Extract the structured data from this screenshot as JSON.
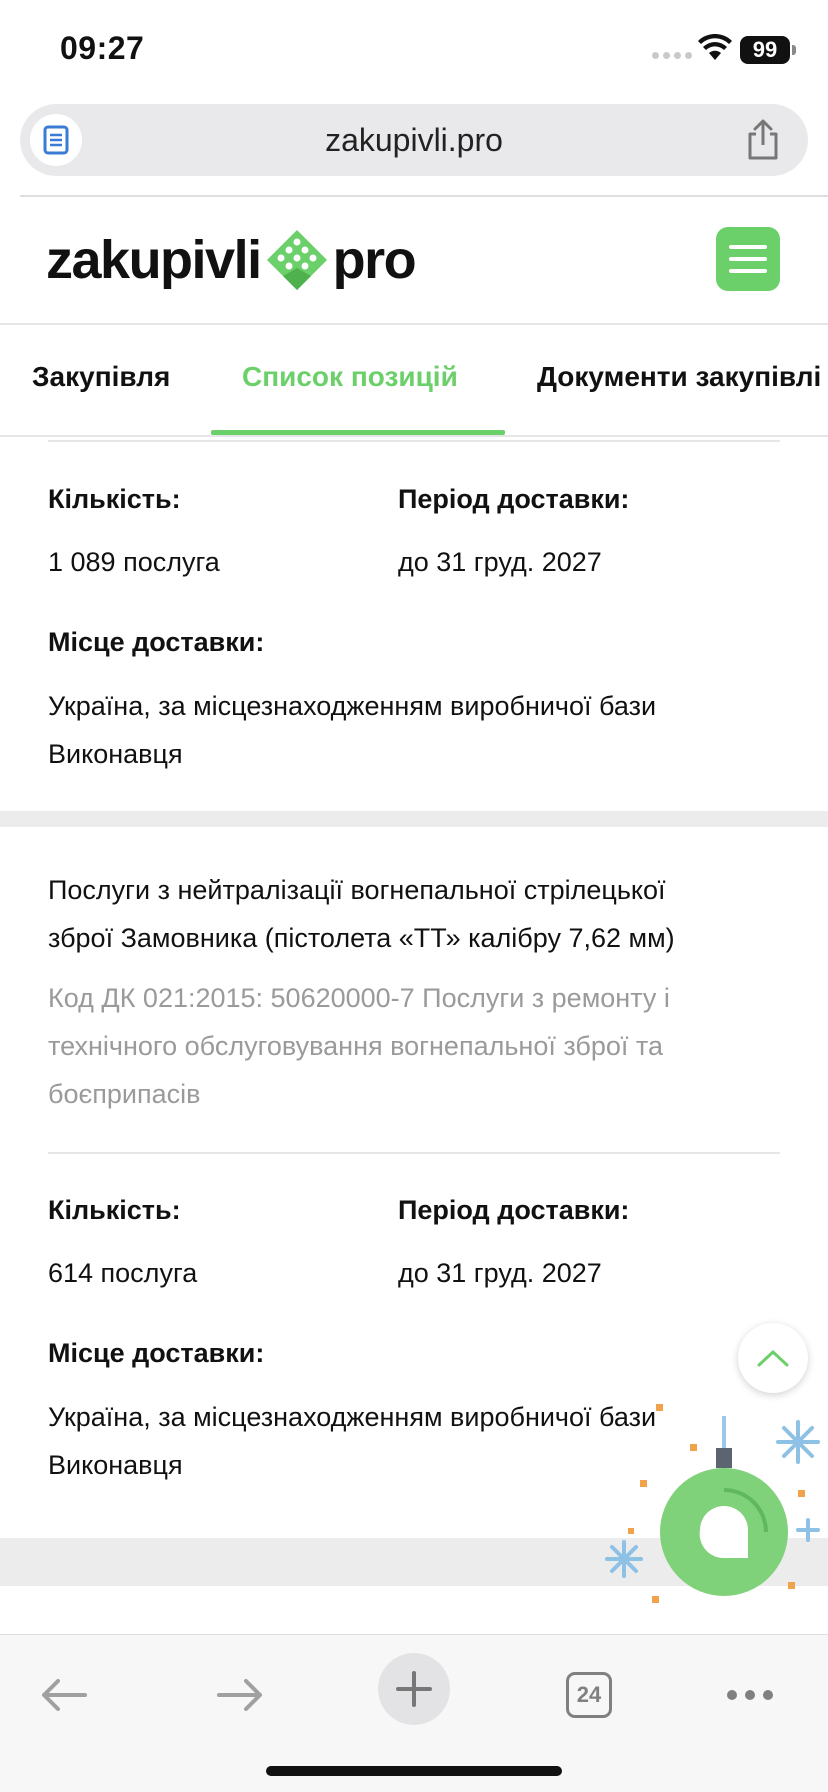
{
  "status_bar": {
    "time": "09:27",
    "battery": "99"
  },
  "browser": {
    "url": "zakupivli.pro",
    "tab_count": "24"
  },
  "site": {
    "logo_left": "zakupivli",
    "logo_right": "pro"
  },
  "tabs": [
    {
      "label": "Закупівля"
    },
    {
      "label": "Список позицій"
    },
    {
      "label": "Документи закупівлі"
    }
  ],
  "items": [
    {
      "quantity_label": "Кількість:",
      "quantity": "1 089 послуга",
      "period_label": "Період доставки:",
      "period": "до 31 груд. 2027",
      "place_label": "Місце доставки:",
      "place_line1": "Україна, за місцезнаходженням виробничої бази",
      "place_line2": "Виконавця"
    },
    {
      "title_line1": "Послуги з нейтралізації вогнепальної стрілецької",
      "title_line2": "зброї Замовника (пістолета «ТТ» калібру 7,62 мм)",
      "code_line1": "Код ДК 021:2015: 50620000-7 Послуги з ремонту і",
      "code_line2": "технічного обслуговування вогнепальної зброї та",
      "code_line3": "боєприпасів",
      "quantity_label": "Кількість:",
      "quantity": "614 послуга",
      "period_label": "Період доставки:",
      "period": "до 31 груд. 2027",
      "place_label": "Місце доставки:",
      "place_line1": "Україна, за місцезнаходженням виробничої бази",
      "place_line2": "Виконавця"
    }
  ],
  "colors": {
    "accent": "#6bd06a",
    "chat": "#7fd27a",
    "muted": "#9a9a9a"
  },
  "icons": [
    "page-icon",
    "share-icon",
    "menu-icon",
    "chevron-up-icon",
    "chat-icon",
    "back-arrow-icon",
    "forward-arrow-icon",
    "plus-icon",
    "more-icon"
  ]
}
